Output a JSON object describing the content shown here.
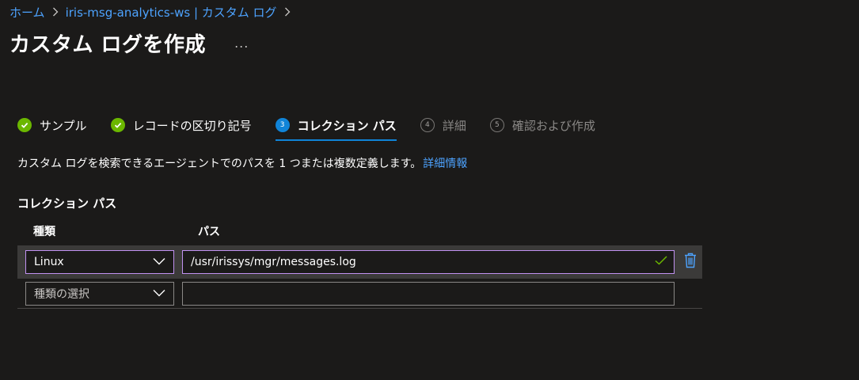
{
  "breadcrumb": {
    "items": [
      "ホーム",
      "iris-msg-analytics-ws | カスタム ログ"
    ]
  },
  "header": {
    "title": "カスタム ログを作成",
    "more_label": "..."
  },
  "steps": [
    {
      "number": "",
      "label": "サンプル",
      "state": "done"
    },
    {
      "number": "",
      "label": "レコードの区切り記号",
      "state": "done"
    },
    {
      "number": "3",
      "label": "コレクション パス",
      "state": "active"
    },
    {
      "number": "4",
      "label": "詳細",
      "state": "pending"
    },
    {
      "number": "5",
      "label": "確認および作成",
      "state": "pending"
    }
  ],
  "description": {
    "text": "カスタム ログを検索できるエージェントでのパスを 1 つまたは複数定義します。",
    "link": "詳細情報"
  },
  "section": {
    "title": "コレクション パス",
    "columns": {
      "type": "種類",
      "path": "パス"
    },
    "rows": [
      {
        "type": "Linux",
        "path": "/usr/irissys/mgr/messages.log"
      },
      {
        "type_placeholder": "種類の選択",
        "path": ""
      }
    ]
  },
  "colors": {
    "background": "#1b1a19",
    "link": "#4da3ff",
    "success": "#6bb700",
    "accent": "#1084d8",
    "focus_border": "#c191f1",
    "delete_icon": "#4da3ff"
  },
  "icons": {
    "step_done": "check-circle-icon",
    "chevron": "chevron-down-icon",
    "valid": "checkmark-icon",
    "delete": "trash-icon"
  }
}
